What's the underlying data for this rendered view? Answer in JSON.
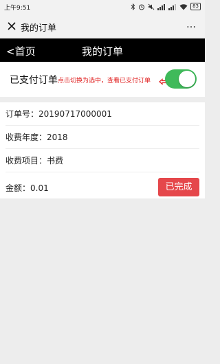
{
  "status_bar": {
    "time": "上午9:51",
    "battery": "83"
  },
  "wx_header": {
    "title": "我的订单",
    "more_icon": "…"
  },
  "nav": {
    "back_label": "<首页",
    "title": "我的订单"
  },
  "filter": {
    "label": "已支付订单",
    "hint": "点击切换为选中，查看已支付订单",
    "toggle_on": true,
    "toggle_color": "#3fba5a",
    "hint_color": "#e02020"
  },
  "order": {
    "number_label": "订单号：",
    "number_value": "20190717000001",
    "year_label": "收费年度：",
    "year_value": "2018",
    "item_label": "收费项目：",
    "item_value": "书费",
    "amount_label": "金额：",
    "amount_value": "0.01",
    "status_label": "已完成",
    "status_color": "#e5474b"
  }
}
